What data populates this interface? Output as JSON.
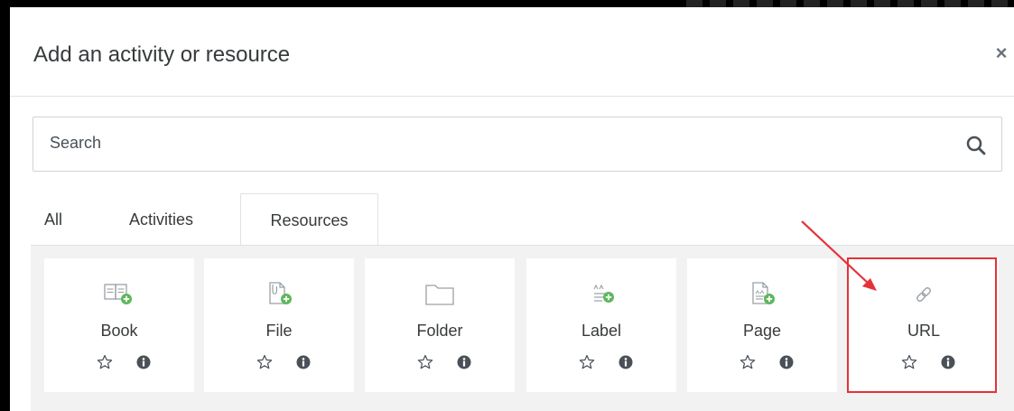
{
  "modal": {
    "title": "Add an activity or resource",
    "close_symbol": "×"
  },
  "search": {
    "placeholder": "Search",
    "icon": "search-icon"
  },
  "tabs": [
    {
      "label": "All",
      "active": false
    },
    {
      "label": "Activities",
      "active": false
    },
    {
      "label": "Resources",
      "active": true
    }
  ],
  "modules": [
    {
      "label": "Book",
      "icon": "book-icon"
    },
    {
      "label": "File",
      "icon": "file-icon"
    },
    {
      "label": "Folder",
      "icon": "folder-icon"
    },
    {
      "label": "Label",
      "icon": "label-icon"
    },
    {
      "label": "Page",
      "icon": "page-icon"
    },
    {
      "label": "URL",
      "icon": "url-link-icon"
    }
  ],
  "annotation": {
    "highlighted_module": "URL",
    "color": "#e53238"
  },
  "colors": {
    "accent_green": "#5cb85c",
    "text": "#373a3c",
    "icon_gray": "#9aa0a6"
  }
}
